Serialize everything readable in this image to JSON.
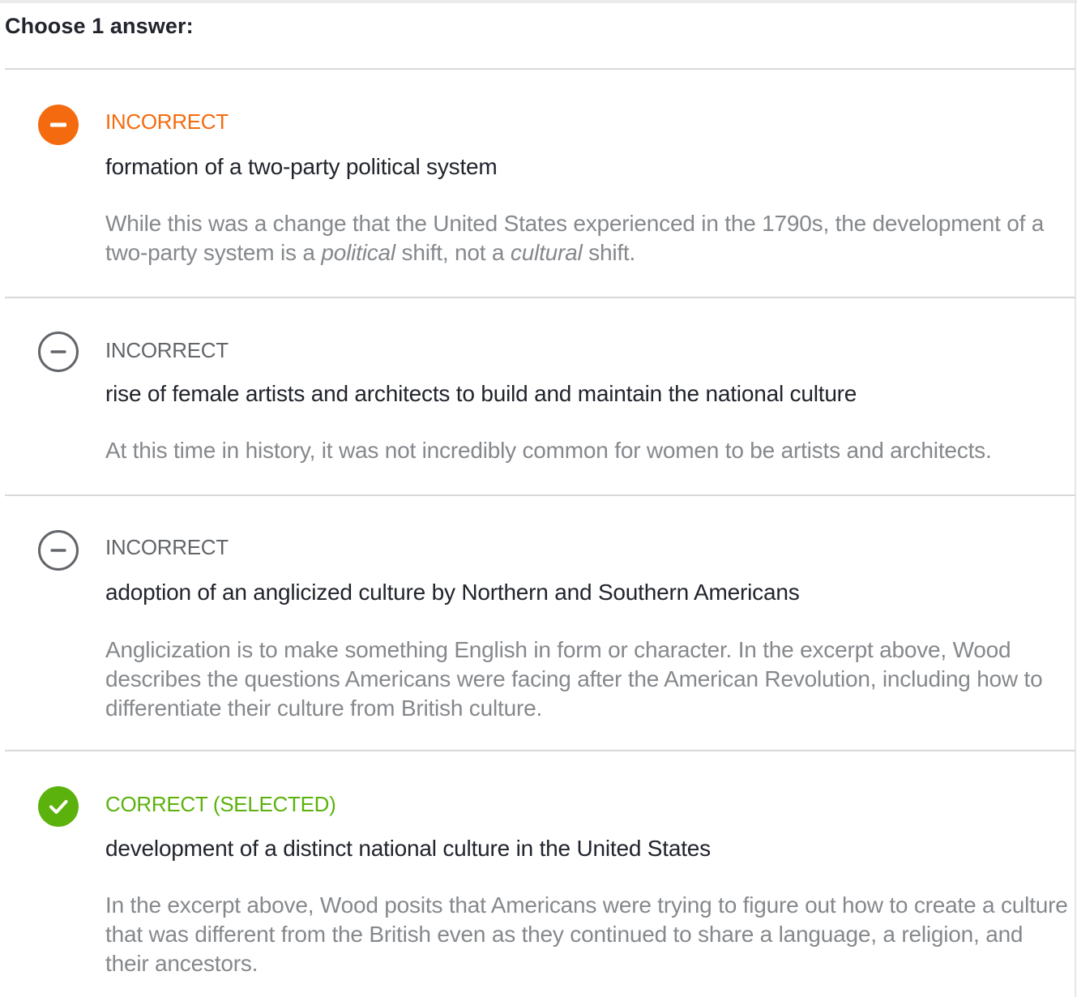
{
  "header": {
    "prompt": "Choose 1 answer:"
  },
  "colors": {
    "incorrect_selected": "#f46b0f",
    "incorrect_unselected": "#626569",
    "correct": "#5cb20c",
    "rationale_text": "#85888c",
    "answer_text": "#21242c"
  },
  "options": [
    {
      "status": "INCORRECT",
      "icon": "minus-circle-filled-icon",
      "answer": "formation of a two-party political system",
      "rationale_before": "While this was a change that the United States experienced in the 1790s, the development of a two-party system is a ",
      "rationale_em1": "political",
      "rationale_mid": " shift, not a ",
      "rationale_em2": "cultural",
      "rationale_after": " shift."
    },
    {
      "status": "INCORRECT",
      "icon": "minus-circle-outline-icon",
      "answer": "rise of female artists and architects to build and maintain the national culture",
      "rationale": "At this time in history, it was not incredibly common for women to be artists and architects."
    },
    {
      "status": "INCORRECT",
      "icon": "minus-circle-outline-icon",
      "answer": "adoption of an anglicized culture by Northern and Southern Americans",
      "rationale": "Anglicization is to make something English in form or character. In the excerpt above, Wood describes the questions Americans were facing after the American Revolution, including how to differentiate their culture from British culture."
    },
    {
      "status": "CORRECT (SELECTED)",
      "icon": "checkmark-circle-filled-icon",
      "answer": "development of a distinct national culture in the United States",
      "rationale": "In the excerpt above, Wood posits that Americans were trying to figure out how to create a culture that was different from the British even as they continued to share a language, a religion, and their ancestors."
    }
  ]
}
